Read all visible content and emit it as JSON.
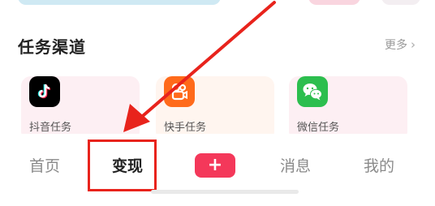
{
  "section": {
    "title": "任务渠道",
    "more_label": "更多"
  },
  "tasks": [
    {
      "label": "抖音任务",
      "icon": "douyin-icon",
      "color": "#000000"
    },
    {
      "label": "快手任务",
      "icon": "kuaishou-icon",
      "color": "#ff6a1a"
    },
    {
      "label": "微信任务",
      "icon": "wechat-icon",
      "color": "#2cbe4e"
    }
  ],
  "nav": {
    "home": "首页",
    "earn": "变现",
    "plus": "+",
    "messages": "消息",
    "me": "我的"
  },
  "colors": {
    "annotation": "#e8231c",
    "accent": "#f4385a"
  }
}
